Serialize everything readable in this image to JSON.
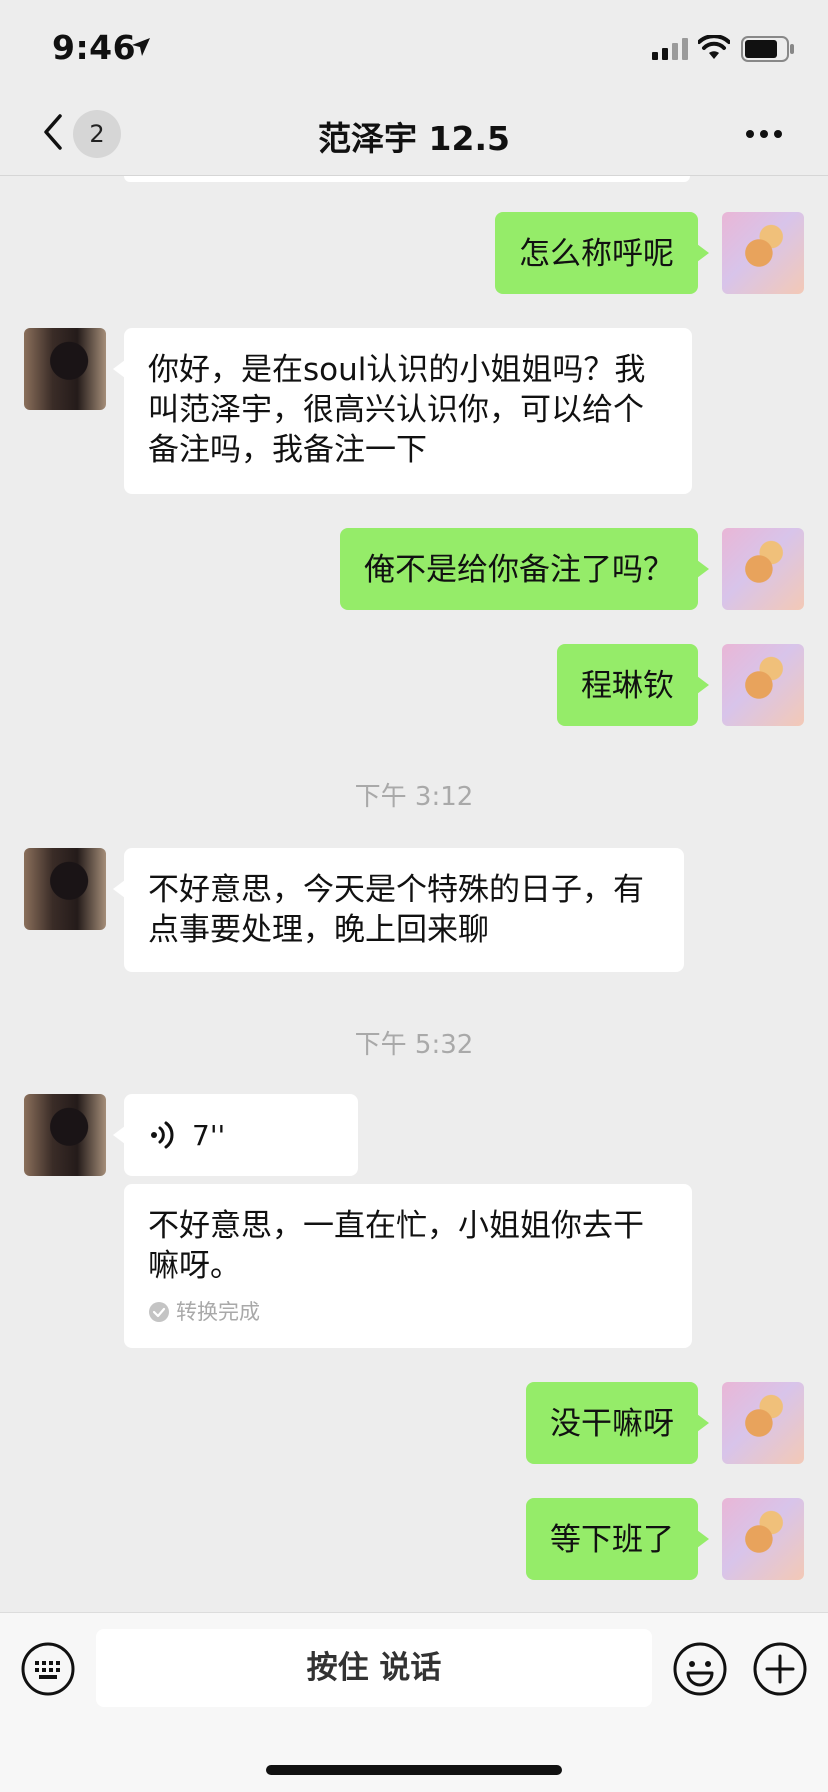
{
  "status": {
    "time": "9:46"
  },
  "nav": {
    "unread_count": "2",
    "title": "范泽宇 12.5"
  },
  "messages": [
    {
      "dir": "out",
      "text": "怎么称呼呢"
    },
    {
      "dir": "in",
      "text": "你好，是在soul认识的小姐姐吗？我叫范泽宇，很高兴认识你，可以给个备注吗，我备注一下"
    },
    {
      "dir": "out",
      "text": "俺不是给你备注了吗？"
    },
    {
      "dir": "out",
      "text": "程琳钦"
    },
    {
      "dir": "in",
      "text": "不好意思，今天是个特殊的日子，有点事要处理，晚上回来聊"
    },
    {
      "dir": "in",
      "voice_duration": "7''"
    },
    {
      "dir": "in",
      "text": "不好意思，一直在忙，小姐姐你去干嘛呀。",
      "status": "转换完成"
    },
    {
      "dir": "out",
      "text": "没干嘛呀"
    },
    {
      "dir": "out",
      "text": "等下班了"
    }
  ],
  "timestamps": [
    "下午 3:12",
    "下午 5:32"
  ],
  "input": {
    "hold_to_talk": "按住 说话"
  },
  "colors": {
    "outgoing_bubble": "#95ec69",
    "incoming_bubble": "#ffffff",
    "background": "#ededed"
  }
}
